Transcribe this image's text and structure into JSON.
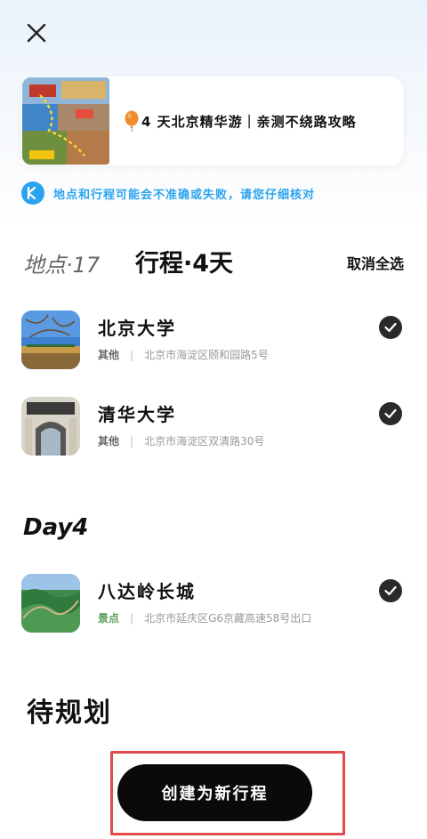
{
  "header": {
    "close_icon": "close-icon"
  },
  "note": {
    "title": "4 天北京精华游｜亲测不绕路攻略",
    "balloon_icon": "balloon-icon"
  },
  "warning": {
    "icon": "info-icon",
    "text": "地点和行程可能会不准确或失败，请您仔细核对",
    "color": "#2aa4ee"
  },
  "tabs": {
    "places": "地点·17",
    "trip": "行程·4天",
    "deselect_all": "取消全选"
  },
  "items": [
    {
      "name": "北京大学",
      "category": "其他",
      "address": "北京市海淀区颐和园路5号",
      "checked": true
    },
    {
      "name": "清华大学",
      "category": "其他",
      "address": "北京市海淀区双清路30号",
      "checked": true
    }
  ],
  "day4": {
    "label": "Day4",
    "items": [
      {
        "name": "八达岭长城",
        "category": "景点",
        "address": "北京市延庆区G6京藏高速58号出口",
        "checked": true
      }
    ]
  },
  "pending": {
    "label": "待规划"
  },
  "create_button": {
    "label": "创建为新行程"
  }
}
